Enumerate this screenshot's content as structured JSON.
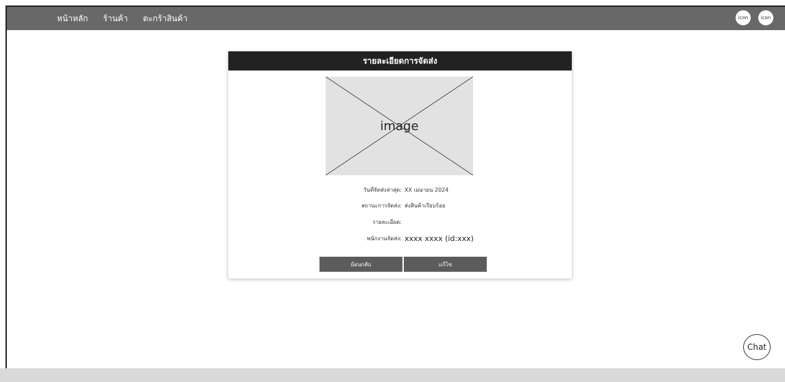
{
  "navbar": {
    "links": [
      "หน้าหลัก",
      "ร้านค้า",
      "ตะกร้าสินค้า"
    ],
    "icons": [
      "icon",
      "icon"
    ]
  },
  "card": {
    "title": "รายละเอียดการจัดส่ง",
    "image_label": "image",
    "details": [
      {
        "label": "วันที่จัดส่งล่าสุด:",
        "value": "XX เมษายน 2024"
      },
      {
        "label": "สถานะการจัดส่ง:",
        "value": "ส่งสินค้าเรียบร้อย"
      },
      {
        "label": "รายละเอียด:",
        "value": ""
      },
      {
        "label": "พนักงานจัดส่ง:",
        "value": "xxxx  xxxx (id:xxx)"
      }
    ],
    "back_label": "ย้อนกลับ",
    "edit_label": "แก้ไข"
  },
  "chat": {
    "label": "Chat"
  }
}
